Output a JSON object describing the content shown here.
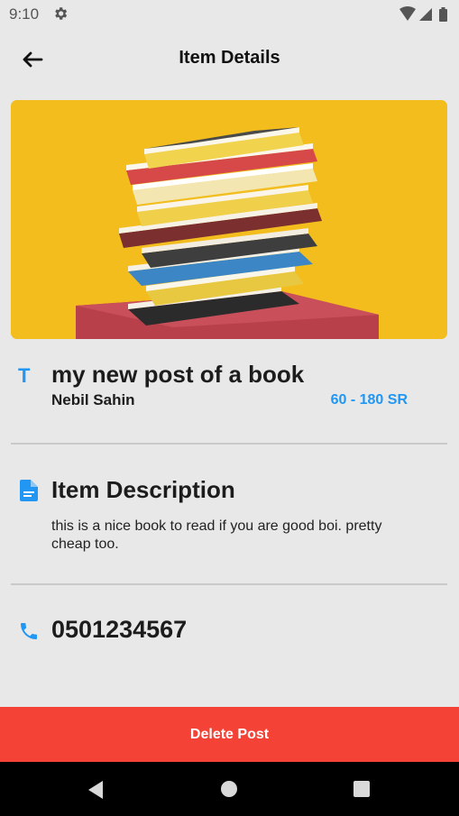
{
  "status_bar": {
    "time": "9:10",
    "settings_icon": "gear-icon",
    "wifi_icon": "wifi-icon",
    "signal_icon": "signal-icon",
    "battery_icon": "battery-icon"
  },
  "app_bar": {
    "back_icon": "arrow-back-icon",
    "title": "Item Details"
  },
  "hero": {
    "image": "stack-of-books-photo",
    "background": "#f2bd1d"
  },
  "item": {
    "title_icon": "text-t-icon",
    "title_icon_glyph": "T",
    "title": "my new post of a book",
    "author": "Nebil Sahin",
    "price": "60 - 180 SR"
  },
  "description": {
    "icon": "document-icon",
    "heading": "Item Description",
    "text": "this is a nice book to read if you are good boi. pretty cheap too."
  },
  "contact": {
    "icon": "phone-icon",
    "phone": "0501234567"
  },
  "actions": {
    "delete_label": "Delete Post"
  },
  "colors": {
    "accent": "#2196f3",
    "danger": "#f44336",
    "background": "#e8e8e8"
  },
  "nav_bar": {
    "back_icon": "nav-back-icon",
    "home_icon": "nav-home-icon",
    "recents_icon": "nav-recents-icon"
  }
}
